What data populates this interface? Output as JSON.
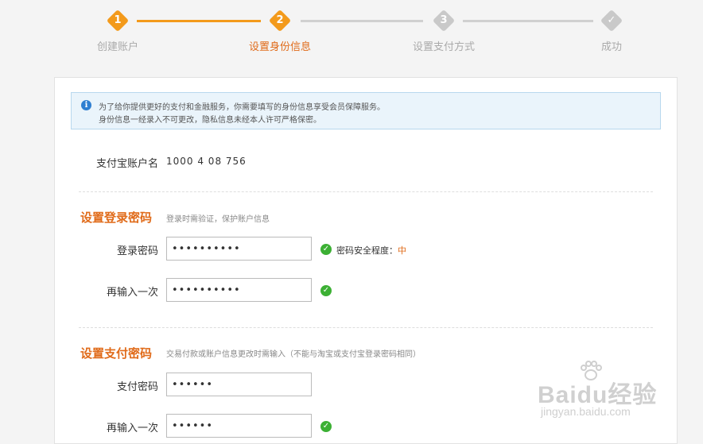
{
  "steps": [
    {
      "num": "1",
      "label": "创建账户",
      "state": "done"
    },
    {
      "num": "2",
      "label": "设置身份信息",
      "state": "active"
    },
    {
      "num": "3",
      "label": "设置支付方式",
      "state": "pending"
    },
    {
      "num": "",
      "label": "成功",
      "state": "pending"
    }
  ],
  "colors": {
    "accent": "#f39a1b",
    "accent_text": "#e06b1a",
    "pending": "#c9c9c9",
    "ok": "#3cb034",
    "info": "#2f7fd1"
  },
  "notice": {
    "icon": "info-icon",
    "line1": "为了给你提供更好的支付和金融服务，你需要填写的身份信息享受会员保障服务。",
    "line2": "身份信息一经录入不可更改，隐私信息未经本人许可严格保密。"
  },
  "account": {
    "label": "支付宝账户名",
    "value": "1000 4 08 756"
  },
  "login_section": {
    "title": "设置登录密码",
    "hint": "登录时需验证，保护账户信息",
    "password_label": "登录密码",
    "password_value": "••••••••••",
    "strength_prefix": "密码安全程度：",
    "strength_level": "中",
    "confirm_label": "再输入一次",
    "confirm_value": "••••••••••"
  },
  "pay_section": {
    "title": "设置支付密码",
    "hint": "交易付款或账户信息更改时需输入（不能与淘宝或支付宝登录密码相同）",
    "password_label": "支付密码",
    "password_value": "••••••",
    "confirm_label": "再输入一次",
    "confirm_value": "••••••"
  },
  "watermark": {
    "text": "Baidu经验",
    "sub": "jingyan.baidu.com"
  }
}
